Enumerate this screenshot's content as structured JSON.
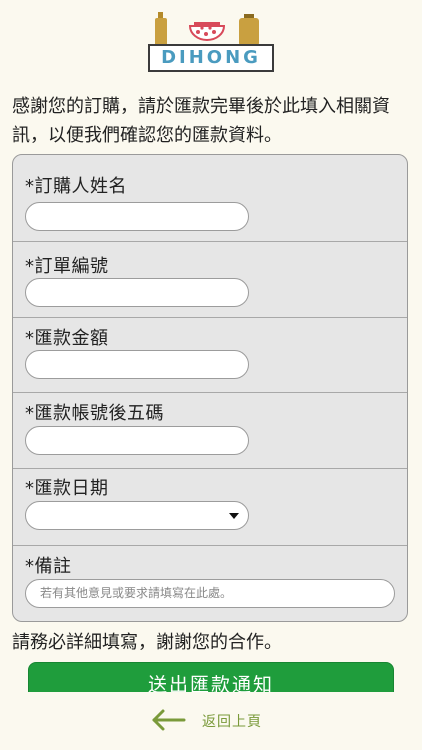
{
  "brand": {
    "logo_text": "DIHONG",
    "accent_color": "#4a9bbf"
  },
  "intro": {
    "text": "感謝您的訂購，請於匯款完畢後於此填入相關資訊，以便我們確認您的匯款資料。"
  },
  "form": {
    "fields": [
      {
        "label": "*訂購人姓名",
        "value": "",
        "type": "text"
      },
      {
        "label": "*訂單編號",
        "value": "",
        "type": "text"
      },
      {
        "label": "*匯款金額",
        "value": "",
        "type": "text"
      },
      {
        "label": "*匯款帳號後五碼",
        "value": "",
        "type": "text"
      },
      {
        "label": "*匯款日期",
        "value": "",
        "type": "select"
      },
      {
        "label": "*備註",
        "value": "",
        "placeholder": "若有其他意見或要求請填寫在此處。",
        "type": "textarea"
      }
    ]
  },
  "closing": {
    "text": "請務必詳細填寫，謝謝您的合作。"
  },
  "actions": {
    "submit_label": "送出匯款通知",
    "submit_color": "#1f9d3c",
    "back_label": "返回上頁",
    "back_color": "#7a9a3a"
  }
}
